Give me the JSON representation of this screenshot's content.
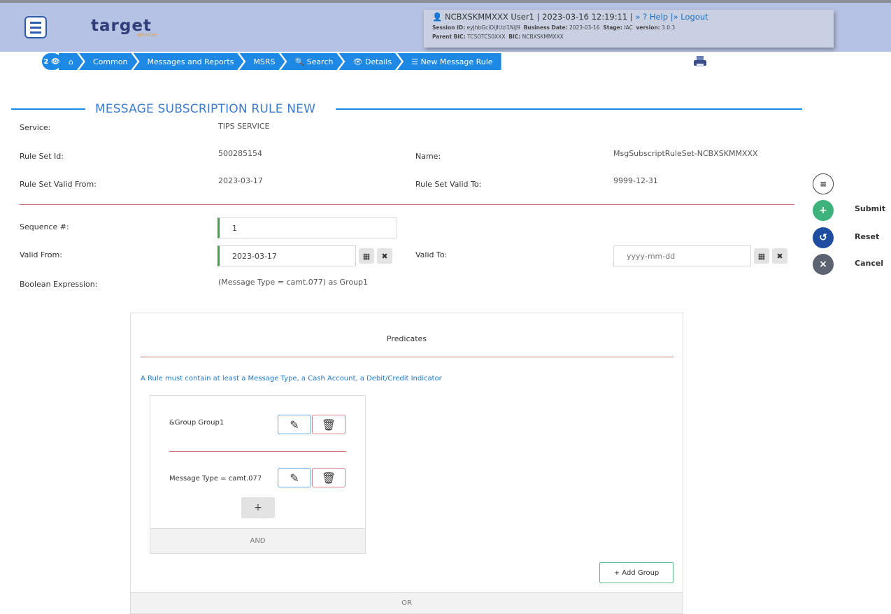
{
  "header": {
    "logo": "target",
    "logo_sub": "services",
    "user": "NCBXSKMMXXX User1",
    "datetime": "| 2023-03-16 12:19:11 |",
    "help": "» ? Help",
    "logout": "|» Logout",
    "session_label": "Session ID:",
    "session_value": "eyJhbGciOiJIUzI1NiJ9",
    "business_date_label": "Business Date:",
    "business_date": "2023-03-16",
    "stage_label": "Stage:",
    "stage": "IAC",
    "version_label": "version:",
    "version": "3.0.3",
    "parent_bic_label": "Parent BIC:",
    "parent_bic": "TCSOTCS0XXX",
    "bic_label": "BIC:",
    "bic": "NCBXSKMMXXX"
  },
  "breadcrumb": {
    "badge": "2",
    "items": [
      "Common",
      "Messages and Reports",
      "MSRS",
      "Search",
      "Details",
      "New Message Rule"
    ]
  },
  "page": {
    "title": "MESSAGE SUBSCRIPTION RULE NEW",
    "service_label": "Service:",
    "service_value": "TIPS SERVICE",
    "rule_set_id_label": "Rule Set Id:",
    "rule_set_id": "500285154",
    "name_label": "Name:",
    "name_value": "MsgSubscriptRuleSet-NCBXSKMMXXX",
    "valid_from_label": "Rule Set Valid From:",
    "valid_from_value": "2023-03-17",
    "valid_to_label": "Rule Set Valid To:",
    "valid_to_value": "9999-12-31",
    "sequence_label": "Sequence #:",
    "sequence_value": "1",
    "rule_valid_from_label": "Valid From:",
    "rule_valid_from_value": "2023-03-17",
    "rule_valid_to_label": "Valid To:",
    "rule_valid_to_placeholder": "yyyy-mm-dd",
    "boolean_label": "Boolean Expression:",
    "boolean_value": "(Message Type = camt.077) as Group1"
  },
  "actions": {
    "submit": "Submit",
    "reset": "Reset",
    "cancel": "Cancel"
  },
  "predicates": {
    "title": "Predicates",
    "info": "A Rule must contain at least a Message Type, a Cash Account, a Debit/Credit Indicator",
    "group_label": "&Group Group1",
    "predicate_label": "Message Type = camt.077",
    "and_label": "AND",
    "or_label": "OR",
    "add_group": "+ Add Group"
  },
  "colors": {
    "accent": "#1e88e5",
    "submit": "#3db27a",
    "reset": "#1f4ea0",
    "cancel": "#5b6470"
  }
}
